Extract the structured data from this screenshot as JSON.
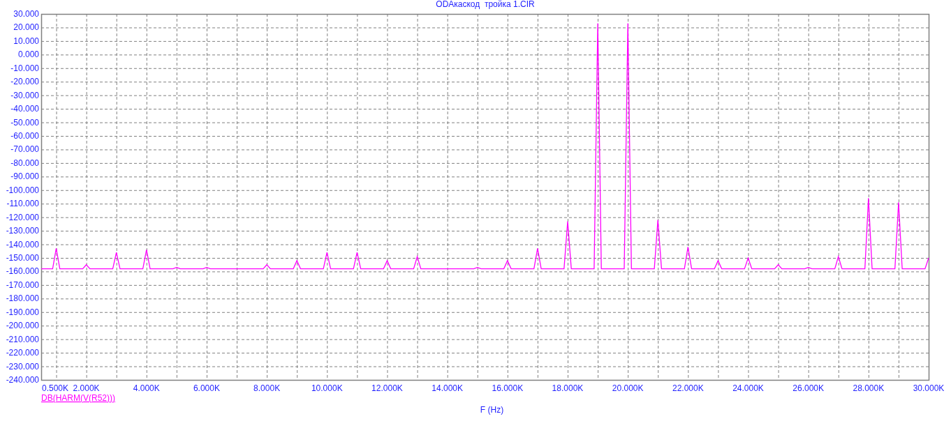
{
  "chart_data": {
    "type": "line",
    "grid": true,
    "title": "ODAкаскод  тройка 1.CIR",
    "xlabel": "F (Hz)",
    "xlim": [
      500,
      30000
    ],
    "ylim": [
      -240,
      30
    ],
    "x": [
      500,
      880,
      1000,
      1120,
      1880,
      2000,
      2120,
      2880,
      3000,
      3120,
      3880,
      4000,
      4120,
      4880,
      5000,
      5120,
      5880,
      6000,
      6120,
      7880,
      8000,
      8120,
      8880,
      9000,
      9120,
      9880,
      10000,
      10120,
      10880,
      11000,
      11120,
      11880,
      12000,
      12120,
      12880,
      13000,
      13120,
      14880,
      15000,
      15120,
      15880,
      16000,
      16120,
      16880,
      17000,
      17120,
      17880,
      18000,
      18120,
      18880,
      19000,
      19120,
      19880,
      20000,
      20120,
      20880,
      21000,
      21120,
      21880,
      22000,
      22120,
      22880,
      23000,
      23120,
      23880,
      24000,
      24120,
      24880,
      25000,
      25120,
      25880,
      26000,
      26120,
      26880,
      27000,
      27120,
      27880,
      28000,
      28120,
      28880,
      29000,
      29120,
      29880,
      30000
    ],
    "series": [
      {
        "name": "DB(HARM(V(R52)))",
        "color": "#ff00ff",
        "values": [
          -158,
          -158,
          -143,
          -158,
          -158,
          -155,
          -158,
          -158,
          -146,
          -158,
          -158,
          -144,
          -158,
          -158,
          -157,
          -158,
          -158,
          -157,
          -158,
          -158,
          -155,
          -158,
          -158,
          -152,
          -158,
          -158,
          -146,
          -158,
          -158,
          -146,
          -158,
          -158,
          -152,
          -158,
          -158,
          -149,
          -158,
          -158,
          -157,
          -158,
          -158,
          -152,
          -158,
          -158,
          -143,
          -158,
          -158,
          -123,
          -158,
          -158,
          23,
          -158,
          -158,
          23,
          -158,
          -158,
          -122,
          -158,
          -158,
          -142,
          -158,
          -158,
          -152,
          -158,
          -158,
          -150,
          -158,
          -158,
          -155,
          -158,
          -158,
          -157,
          -158,
          -158,
          -149,
          -158,
          -158,
          -106,
          -158,
          -158,
          -109,
          -158,
          -158,
          -150
        ]
      }
    ],
    "xticks": [
      {
        "value": 500,
        "label": "0.500K"
      },
      {
        "value": 2000,
        "label": "2.000K"
      },
      {
        "value": 4000,
        "label": "4.000K"
      },
      {
        "value": 6000,
        "label": "6.000K"
      },
      {
        "value": 8000,
        "label": "8.000K"
      },
      {
        "value": 10000,
        "label": "10.000K"
      },
      {
        "value": 12000,
        "label": "12.000K"
      },
      {
        "value": 14000,
        "label": "14.000K"
      },
      {
        "value": 16000,
        "label": "16.000K"
      },
      {
        "value": 18000,
        "label": "18.000K"
      },
      {
        "value": 20000,
        "label": "20.000K"
      },
      {
        "value": 22000,
        "label": "22.000K"
      },
      {
        "value": 24000,
        "label": "24.000K"
      },
      {
        "value": 26000,
        "label": "26.000K"
      },
      {
        "value": 28000,
        "label": "28.000K"
      },
      {
        "value": 30000,
        "label": "30.000K"
      }
    ],
    "yticks": [
      {
        "value": 30,
        "label": "30.000"
      },
      {
        "value": 20,
        "label": "20.000"
      },
      {
        "value": 10,
        "label": "10.000"
      },
      {
        "value": 0,
        "label": "0.000"
      },
      {
        "value": -10,
        "label": "-10.000"
      },
      {
        "value": -20,
        "label": "-20.000"
      },
      {
        "value": -30,
        "label": "-30.000"
      },
      {
        "value": -40,
        "label": "-40.000"
      },
      {
        "value": -50,
        "label": "-50.000"
      },
      {
        "value": -60,
        "label": "-60.000"
      },
      {
        "value": -70,
        "label": "-70.000"
      },
      {
        "value": -80,
        "label": "-80.000"
      },
      {
        "value": -90,
        "label": "-90.000"
      },
      {
        "value": -100,
        "label": "-100.000"
      },
      {
        "value": -110,
        "label": "-110.000"
      },
      {
        "value": -120,
        "label": "-120.000"
      },
      {
        "value": -130,
        "label": "-130.000"
      },
      {
        "value": -140,
        "label": "-140.000"
      },
      {
        "value": -150,
        "label": "-150.000"
      },
      {
        "value": -160,
        "label": "-160.000"
      },
      {
        "value": -170,
        "label": "-170.000"
      },
      {
        "value": -180,
        "label": "-180.000"
      },
      {
        "value": -190,
        "label": "-190.000"
      },
      {
        "value": -200,
        "label": "-200.000"
      },
      {
        "value": -210,
        "label": "-210.000"
      },
      {
        "value": -220,
        "label": "-220.000"
      },
      {
        "value": -230,
        "label": "-230.000"
      },
      {
        "value": -240,
        "label": "-240.000"
      }
    ]
  }
}
